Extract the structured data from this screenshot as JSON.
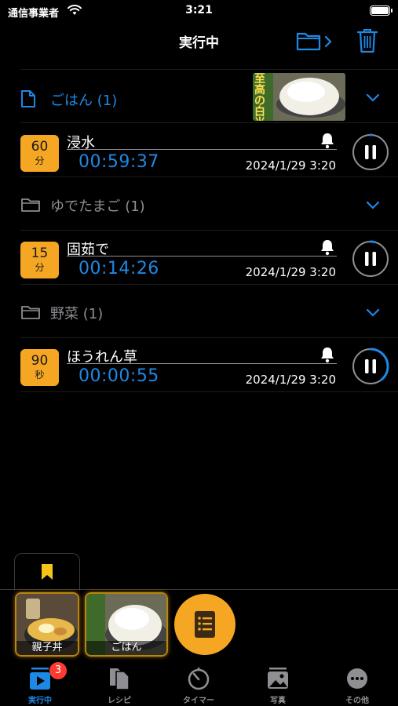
{
  "status_bar": {
    "carrier": "通信事業者",
    "time": "3:21"
  },
  "nav": {
    "title": "実行中"
  },
  "groups": [
    {
      "title": "ごはん",
      "count": "(1)",
      "active": true,
      "icon": "document-icon",
      "timers": [
        {
          "badge_num": "60",
          "badge_unit": "分",
          "name": "浸水",
          "remaining": "00:59:37",
          "started": "2024/1/29 3:20",
          "progress": 0.01
        }
      ]
    },
    {
      "title": "ゆでたまご",
      "count": "(1)",
      "active": false,
      "icon": "folder-icon",
      "timers": [
        {
          "badge_num": "15",
          "badge_unit": "分",
          "name": "固茹で",
          "remaining": "00:14:26",
          "started": "2024/1/29 3:20",
          "progress": 0.04
        }
      ]
    },
    {
      "title": "野菜",
      "count": "(1)",
      "active": false,
      "icon": "folder-icon",
      "timers": [
        {
          "badge_num": "90",
          "badge_unit": "秒",
          "name": "ほうれん草",
          "remaining": "00:00:55",
          "started": "2024/1/29 3:20",
          "progress": 0.39
        }
      ]
    }
  ],
  "thumbnail_text": "至高の白米",
  "dock": {
    "cards": [
      {
        "label": "親子丼"
      },
      {
        "label": "ごはん"
      }
    ]
  },
  "tabbar": {
    "tabs": [
      {
        "label": "実行中",
        "active": true,
        "badge": "3"
      },
      {
        "label": "レシピ"
      },
      {
        "label": "タイマー"
      },
      {
        "label": "写真"
      },
      {
        "label": "その他"
      }
    ]
  },
  "colors": {
    "accent": "#1e88e5",
    "badge": "#f5a623",
    "muted": "#8e8e93",
    "alert": "#ff3b30"
  }
}
